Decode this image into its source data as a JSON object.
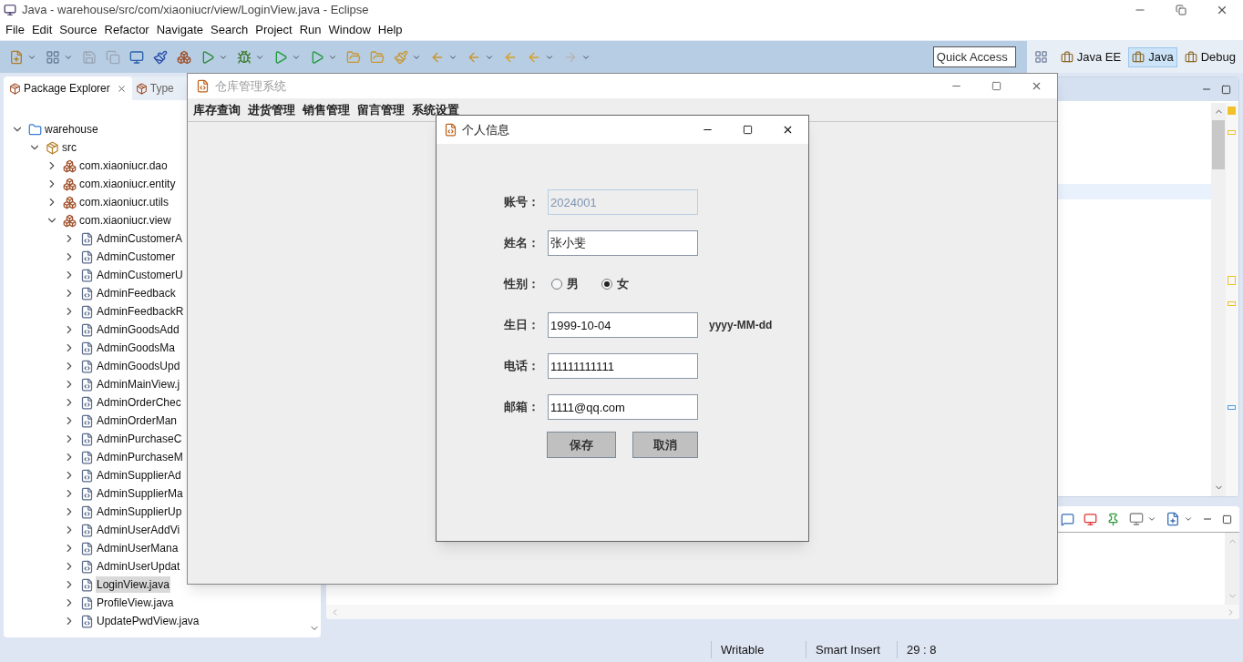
{
  "window": {
    "title": "Java - warehouse/src/com/xiaoniucr/view/LoginView.java - Eclipse"
  },
  "menu": [
    "File",
    "Edit",
    "Source",
    "Refactor",
    "Navigate",
    "Search",
    "Project",
    "Run",
    "Window",
    "Help"
  ],
  "quick_access": {
    "placeholder": "Quick Access"
  },
  "perspectives": [
    {
      "label": "Java EE",
      "selected": false
    },
    {
      "label": "Java",
      "selected": true
    },
    {
      "label": "Debug",
      "selected": false
    }
  ],
  "explorer_tabs": [
    {
      "label": "Package Explorer",
      "selected": true
    },
    {
      "label": "Type",
      "selected": false
    }
  ],
  "tree": [
    {
      "kind": "project",
      "label": "warehouse",
      "expanded": true,
      "selected": false,
      "children": [
        {
          "kind": "source",
          "label": "src",
          "expanded": true,
          "selected": false,
          "children": [
            {
              "kind": "package",
              "label": "com.xiaoniucr.dao",
              "expanded": false,
              "selected": false
            },
            {
              "kind": "package",
              "label": "com.xiaoniucr.entity",
              "expanded": false,
              "selected": false
            },
            {
              "kind": "package",
              "label": "com.xiaoniucr.utils",
              "expanded": false,
              "selected": false
            },
            {
              "kind": "package",
              "label": "com.xiaoniucr.view",
              "expanded": true,
              "selected": false,
              "children": [
                {
                  "kind": "file",
                  "label": "AdminCustomerA",
                  "expanded": false,
                  "selected": false
                },
                {
                  "kind": "file",
                  "label": "AdminCustomer",
                  "expanded": false,
                  "selected": false
                },
                {
                  "kind": "file",
                  "label": "AdminCustomerU",
                  "expanded": false,
                  "selected": false
                },
                {
                  "kind": "file",
                  "label": "AdminFeedback",
                  "expanded": false,
                  "selected": false
                },
                {
                  "kind": "file",
                  "label": "AdminFeedbackR",
                  "expanded": false,
                  "selected": false
                },
                {
                  "kind": "file",
                  "label": "AdminGoodsAdd",
                  "expanded": false,
                  "selected": false
                },
                {
                  "kind": "file",
                  "label": "AdminGoodsMa",
                  "expanded": false,
                  "selected": false
                },
                {
                  "kind": "file",
                  "label": "AdminGoodsUpd",
                  "expanded": false,
                  "selected": false
                },
                {
                  "kind": "file",
                  "label": "AdminMainView.j",
                  "expanded": false,
                  "selected": false
                },
                {
                  "kind": "file",
                  "label": "AdminOrderChec",
                  "expanded": false,
                  "selected": false
                },
                {
                  "kind": "file",
                  "label": "AdminOrderMan",
                  "expanded": false,
                  "selected": false
                },
                {
                  "kind": "file",
                  "label": "AdminPurchaseC",
                  "expanded": false,
                  "selected": false
                },
                {
                  "kind": "file",
                  "label": "AdminPurchaseM",
                  "expanded": false,
                  "selected": false
                },
                {
                  "kind": "file",
                  "label": "AdminSupplierAd",
                  "expanded": false,
                  "selected": false
                },
                {
                  "kind": "file",
                  "label": "AdminSupplierMa",
                  "expanded": false,
                  "selected": false
                },
                {
                  "kind": "file",
                  "label": "AdminSupplierUp",
                  "expanded": false,
                  "selected": false
                },
                {
                  "kind": "file",
                  "label": "AdminUserAddVi",
                  "expanded": false,
                  "selected": false
                },
                {
                  "kind": "file",
                  "label": "AdminUserMana",
                  "expanded": false,
                  "selected": false
                },
                {
                  "kind": "file",
                  "label": "AdminUserUpdat",
                  "expanded": false,
                  "selected": false
                },
                {
                  "kind": "file",
                  "label": "LoginView.java",
                  "expanded": false,
                  "selected": true
                },
                {
                  "kind": "file",
                  "label": "ProfileView.java",
                  "expanded": false,
                  "selected": false
                },
                {
                  "kind": "file",
                  "label": "UpdatePwdView.java",
                  "expanded": false,
                  "selected": false
                }
              ]
            }
          ]
        }
      ]
    }
  ],
  "status_bar": [
    "Writable",
    "Smart Insert",
    "29 : 8"
  ],
  "app_window": {
    "title": "仓库管理系统",
    "menu": [
      "库存查询",
      "进货管理",
      "销售管理",
      "留言管理",
      "系统设置"
    ]
  },
  "dialog": {
    "title": "个人信息",
    "fields": [
      {
        "kind": "text",
        "label": "账号：",
        "value": "2024001",
        "disabled": true
      },
      {
        "kind": "text",
        "label": "姓名：",
        "value": "张小斐",
        "disabled": false
      },
      {
        "kind": "radio",
        "label": "性别：",
        "options": [
          {
            "label": "男",
            "selected": false
          },
          {
            "label": "女",
            "selected": true
          }
        ]
      },
      {
        "kind": "text",
        "label": "生日：",
        "value": "1999-10-04",
        "disabled": false,
        "hint": "yyyy-MM-dd"
      },
      {
        "kind": "text",
        "label": "电话：",
        "value": "11111111111",
        "disabled": false
      },
      {
        "kind": "text",
        "label": "邮箱：",
        "value": "1111@qq.com",
        "disabled": false
      }
    ],
    "buttons": [
      "保存",
      "取消"
    ]
  }
}
